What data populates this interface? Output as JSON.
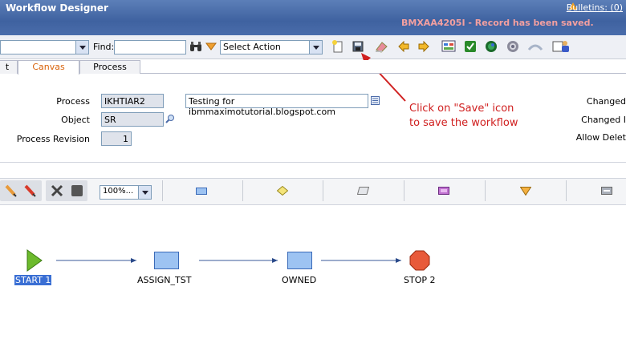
{
  "app": {
    "title": "Workflow Designer",
    "bulletins_label": "Bulletins: (0)",
    "status_message": "BMXAA4205I - Record has been saved."
  },
  "toolbar": {
    "find_label": "Find:",
    "find_value": "",
    "select_action": "Select Action",
    "icons": [
      "binoculars-icon",
      "filter-arrow-icon",
      "new-record-icon",
      "save-icon",
      "clear-changes-icon",
      "previous-record-icon",
      "next-record-icon",
      "bulk-edit-icon",
      "validate-icon",
      "enable-icon",
      "activate-icon",
      "undo-icon",
      "assign-user-icon"
    ]
  },
  "tabs": [
    {
      "label": "t",
      "active": false
    },
    {
      "label": "Canvas",
      "active": true
    },
    {
      "label": "Process",
      "active": false
    }
  ],
  "form": {
    "process_label": "Process",
    "process_value": "IKHTIAR2",
    "description_value": "Testing for ibmmaximotutorial.blogspot.com",
    "object_label": "Object",
    "object_value": "SR",
    "revision_label": "Process Revision",
    "revision_value": "1",
    "right_labels": [
      "Changed",
      "Changed I",
      "Allow Delet"
    ]
  },
  "annotation": {
    "line1": "Click on \"Save\" icon",
    "line2": "to save the workflow"
  },
  "canvas_toolbar": {
    "zoom_value": "100%...",
    "palette": [
      "task-node-tool-icon",
      "condition-node-tool-icon",
      "input-node-tool-icon",
      "subprocess-node-tool-icon",
      "wait-node-tool-icon",
      "stop-node-tool-icon"
    ]
  },
  "canvas": {
    "nodes": [
      {
        "label": "START 1",
        "type": "start"
      },
      {
        "label": "ASSIGN_TST",
        "type": "task"
      },
      {
        "label": "OWNED",
        "type": "task"
      },
      {
        "label": "STOP 2",
        "type": "stop"
      }
    ]
  },
  "colors": {
    "title_bar": "#4a6dab",
    "status_message": "#f4a0a0",
    "annotation": "#d02020",
    "active_tab": "#d8620a",
    "start_node": "#6cba2c",
    "task_node": "#9dc3f2",
    "stop_node": "#e85a3a"
  }
}
